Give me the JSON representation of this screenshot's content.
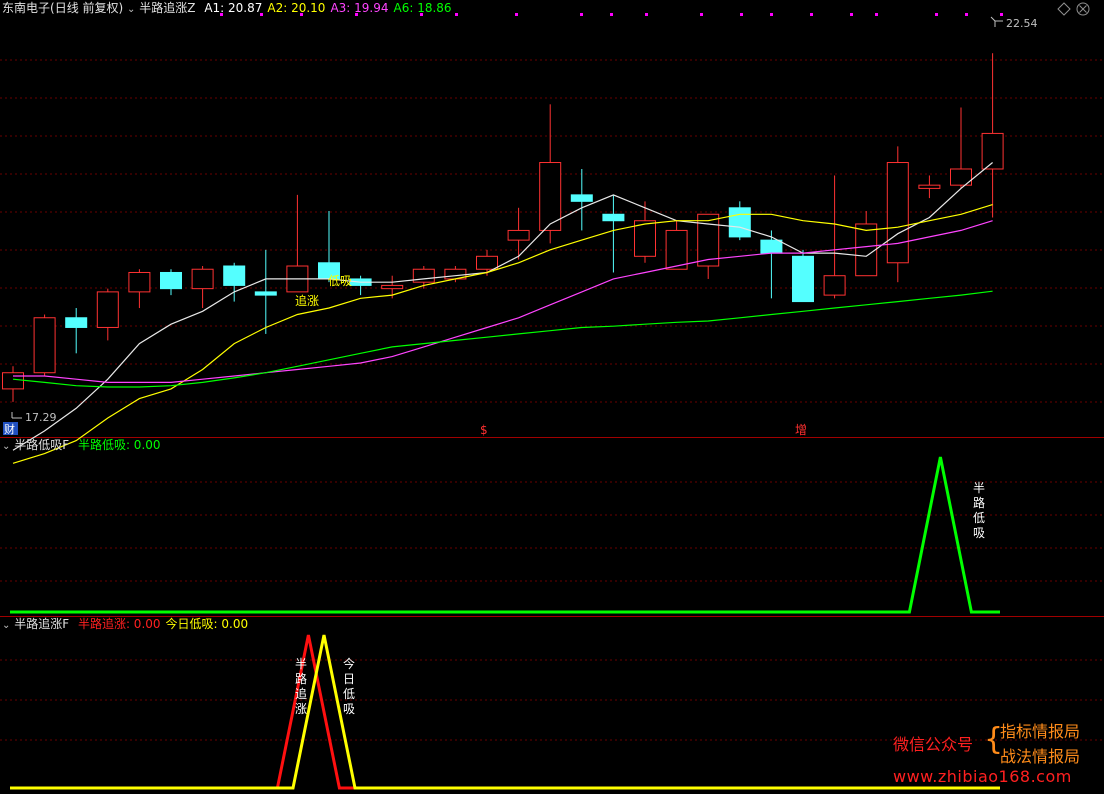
{
  "main_panel": {
    "stock_name": "东南电子",
    "period": "(日线 前复权)",
    "indicator_name": "半路追涨Z",
    "readouts": [
      {
        "label": "A1: ",
        "value": "20.87",
        "color": "#ffffff"
      },
      {
        "label": "A2: ",
        "value": "20.10",
        "color": "#ffff00"
      },
      {
        "label": "A3: ",
        "value": "19.94",
        "color": "#ff44ff"
      },
      {
        "label": "A6: ",
        "value": "18.86",
        "color": "#00ff00"
      }
    ],
    "high_label": "22.54",
    "low_label": "17.29",
    "markers": {
      "finance": "财",
      "dollar": "$",
      "increase": "增"
    },
    "candle_labels": {
      "chase": "追涨",
      "dip": "低吸"
    }
  },
  "panel2": {
    "indicator_name": "半路低吸F",
    "readouts": [
      {
        "label": "半路低吸: ",
        "value": "0.00",
        "color": "#00ff00"
      }
    ],
    "signal_label": "半路低吸"
  },
  "panel3": {
    "indicator_name": "半路追涨F",
    "readouts": [
      {
        "label": "半路追涨: ",
        "value": "0.00",
        "color": "#ff2020"
      },
      {
        "label": "今日低吸: ",
        "value": "0.00",
        "color": "#ffff00"
      }
    ],
    "signal_chase": "半路追涨",
    "signal_dip": "今日低吸"
  },
  "watermark": {
    "wechat": "微信公众号",
    "brand1": "指标情报局",
    "brand2": "战法情报局",
    "url": "www.zhibiao168.com"
  },
  "chart_data": {
    "type": "candlestick",
    "y_range": [
      16.9,
      23.1
    ],
    "candles": [
      {
        "o": 17.35,
        "h": 17.7,
        "l": 17.15,
        "c": 17.6
      },
      {
        "o": 17.6,
        "h": 18.5,
        "l": 17.55,
        "c": 18.45
      },
      {
        "o": 18.45,
        "h": 18.6,
        "l": 17.9,
        "c": 18.3
      },
      {
        "o": 18.3,
        "h": 18.9,
        "l": 18.1,
        "c": 18.85
      },
      {
        "o": 18.85,
        "h": 19.2,
        "l": 18.6,
        "c": 19.15
      },
      {
        "o": 19.15,
        "h": 19.2,
        "l": 18.8,
        "c": 18.9
      },
      {
        "o": 18.9,
        "h": 19.25,
        "l": 18.6,
        "c": 19.2
      },
      {
        "o": 19.25,
        "h": 19.3,
        "l": 18.7,
        "c": 18.95
      },
      {
        "o": 18.85,
        "h": 19.5,
        "l": 18.2,
        "c": 18.8
      },
      {
        "o": 18.85,
        "h": 20.35,
        "l": 18.85,
        "c": 19.25
      },
      {
        "o": 19.3,
        "h": 20.1,
        "l": 19.0,
        "c": 19.05
      },
      {
        "o": 19.05,
        "h": 19.1,
        "l": 18.8,
        "c": 18.95
      },
      {
        "o": 18.9,
        "h": 19.1,
        "l": 18.75,
        "c": 18.95
      },
      {
        "o": 19.0,
        "h": 19.25,
        "l": 18.9,
        "c": 19.2
      },
      {
        "o": 19.05,
        "h": 19.25,
        "l": 19.0,
        "c": 19.2
      },
      {
        "o": 19.2,
        "h": 19.5,
        "l": 19.1,
        "c": 19.4
      },
      {
        "o": 19.65,
        "h": 20.15,
        "l": 19.35,
        "c": 19.8
      },
      {
        "o": 19.8,
        "h": 21.75,
        "l": 19.6,
        "c": 20.85
      },
      {
        "o": 20.35,
        "h": 20.75,
        "l": 19.8,
        "c": 20.25
      },
      {
        "o": 20.05,
        "h": 20.35,
        "l": 19.15,
        "c": 19.95
      },
      {
        "o": 19.4,
        "h": 20.25,
        "l": 19.3,
        "c": 19.95
      },
      {
        "o": 19.2,
        "h": 19.95,
        "l": 19.2,
        "c": 19.8
      },
      {
        "o": 19.25,
        "h": 20.05,
        "l": 19.05,
        "c": 20.05
      },
      {
        "o": 20.15,
        "h": 20.25,
        "l": 19.65,
        "c": 19.7
      },
      {
        "o": 19.65,
        "h": 19.8,
        "l": 18.75,
        "c": 19.45
      },
      {
        "o": 19.4,
        "h": 19.5,
        "l": 18.7,
        "c": 18.7
      },
      {
        "o": 18.8,
        "h": 20.65,
        "l": 18.75,
        "c": 19.1
      },
      {
        "o": 19.1,
        "h": 20.1,
        "l": 19.1,
        "c": 19.9
      },
      {
        "o": 19.3,
        "h": 21.1,
        "l": 19.0,
        "c": 20.85
      },
      {
        "o": 20.45,
        "h": 20.65,
        "l": 20.3,
        "c": 20.5
      },
      {
        "o": 20.5,
        "h": 21.7,
        "l": 20.45,
        "c": 20.75
      },
      {
        "o": 20.75,
        "h": 22.54,
        "l": 20.0,
        "c": 21.3
      }
    ],
    "series": [
      {
        "name": "A1",
        "color": "#e8e8e8",
        "values": [
          16.4,
          16.7,
          17.05,
          17.5,
          18.05,
          18.35,
          18.55,
          18.85,
          19.05,
          19.05,
          19.05,
          19.0,
          19.0,
          19.05,
          19.1,
          19.15,
          19.4,
          19.9,
          20.15,
          20.35,
          20.15,
          19.95,
          19.9,
          19.85,
          19.7,
          19.45,
          19.45,
          19.4,
          19.75,
          20.0,
          20.45,
          20.85
        ]
      },
      {
        "name": "A2",
        "color": "#ffff00",
        "values": [
          16.2,
          16.35,
          16.55,
          16.9,
          17.2,
          17.35,
          17.65,
          18.05,
          18.3,
          18.5,
          18.6,
          18.75,
          18.8,
          18.95,
          19.05,
          19.15,
          19.3,
          19.5,
          19.65,
          19.8,
          19.9,
          19.95,
          19.95,
          20.05,
          20.05,
          19.95,
          19.9,
          19.8,
          19.85,
          19.95,
          20.05,
          20.2
        ]
      },
      {
        "name": "A3",
        "color": "#ff44ff",
        "values": [
          17.55,
          17.55,
          17.5,
          17.45,
          17.45,
          17.45,
          17.5,
          17.55,
          17.6,
          17.65,
          17.7,
          17.75,
          17.85,
          18.0,
          18.15,
          18.3,
          18.45,
          18.65,
          18.85,
          19.05,
          19.15,
          19.25,
          19.35,
          19.4,
          19.45,
          19.45,
          19.5,
          19.55,
          19.6,
          19.7,
          19.8,
          19.95
        ]
      },
      {
        "name": "A6",
        "color": "#00ff00",
        "values": [
          17.5,
          17.45,
          17.4,
          17.38,
          17.38,
          17.4,
          17.45,
          17.52,
          17.6,
          17.7,
          17.8,
          17.9,
          18.0,
          18.05,
          18.1,
          18.15,
          18.2,
          18.25,
          18.3,
          18.32,
          18.35,
          18.38,
          18.4,
          18.45,
          18.5,
          18.55,
          18.6,
          18.65,
          18.7,
          18.75,
          18.8,
          18.86
        ]
      }
    ],
    "signal_panel2": [
      0,
      0,
      0,
      0,
      0,
      0,
      0,
      0,
      0,
      0,
      0,
      0,
      0,
      0,
      0,
      0,
      0,
      0,
      0,
      0,
      0,
      0,
      0,
      0,
      0,
      0,
      0,
      0,
      0,
      1,
      0,
      0
    ],
    "signal_chase": [
      0,
      0,
      0,
      0,
      0,
      0,
      0,
      0,
      0,
      1,
      0,
      0,
      0,
      0,
      0,
      0,
      0,
      0,
      0,
      0,
      0,
      0,
      0,
      0,
      0,
      0,
      0,
      0,
      0,
      0,
      0,
      0
    ],
    "signal_dip": [
      0,
      0,
      0,
      0,
      0,
      0,
      0,
      0,
      0,
      0,
      1,
      0,
      0,
      0,
      0,
      0,
      0,
      0,
      0,
      0,
      0,
      0,
      0,
      0,
      0,
      0,
      0,
      0,
      0,
      0,
      0,
      0
    ]
  }
}
